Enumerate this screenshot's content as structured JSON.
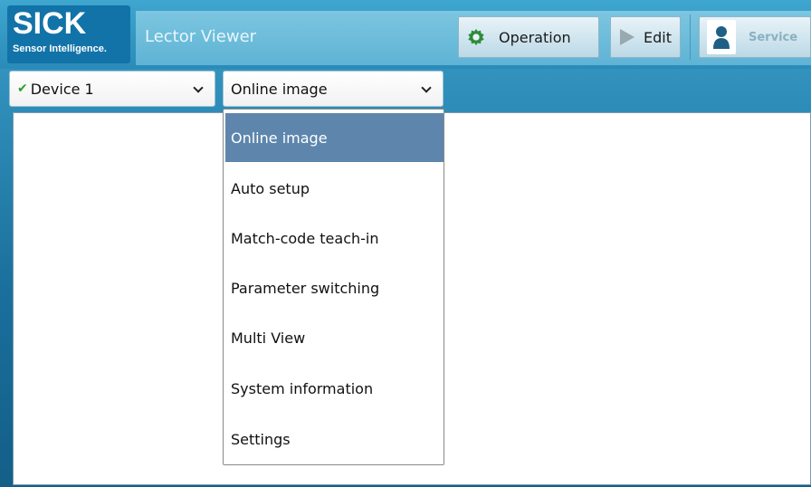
{
  "header": {
    "logo_main": "SICK",
    "logo_sub": "Sensor Intelligence.",
    "app_title": "Lector Viewer",
    "buttons": {
      "operation": "Operation",
      "edit": "Edit",
      "service": "Service"
    },
    "icons": {
      "operation": "gear-icon",
      "edit": "play-icon",
      "service": "user-icon"
    }
  },
  "toolbar": {
    "device_select": {
      "value": "Device 1",
      "status_icon": "check-icon"
    },
    "view_select": {
      "value": "Online image"
    }
  },
  "dropdown": {
    "items": [
      {
        "label": "Online image",
        "selected": true
      },
      {
        "label": "Auto setup"
      },
      {
        "label": "Match-code teach-in"
      },
      {
        "label": "Parameter switching"
      },
      {
        "label": "Multi View"
      },
      {
        "label": "System information"
      },
      {
        "label": "Settings"
      }
    ]
  },
  "colors": {
    "brand_blue": "#1273a8",
    "selected_item": "#5e86ad",
    "gear_green": "#2e8b3a",
    "check_green": "#2aa030"
  }
}
